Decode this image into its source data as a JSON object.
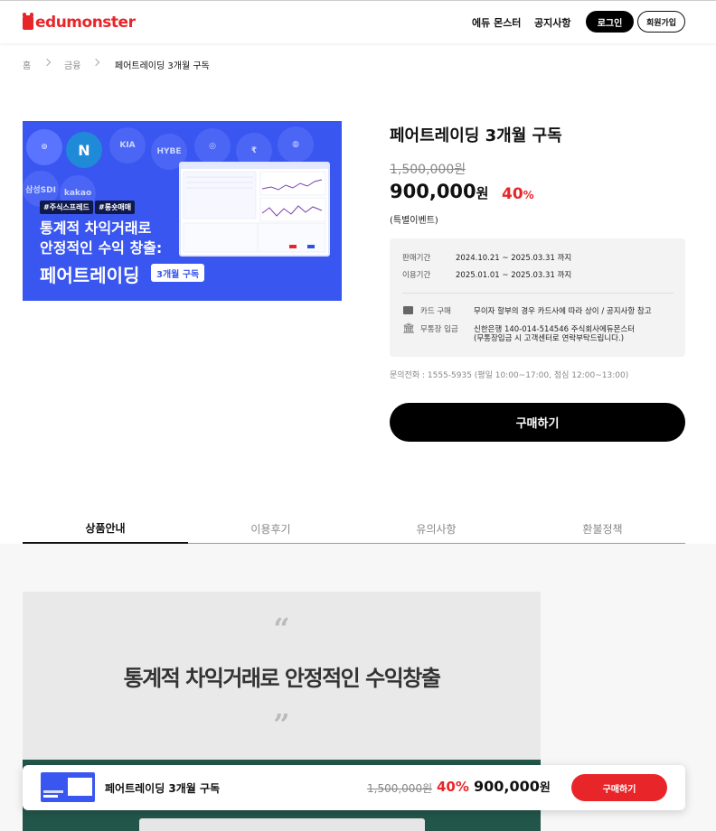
{
  "header": {
    "logo_text": "edumonster",
    "nav": [
      "에듀 몬스터",
      "공지사항"
    ],
    "login_label": "로그인",
    "join_label": "회원가입"
  },
  "breadcrumb": [
    "홈",
    "금융",
    "페어트레이딩 3개월 구독"
  ],
  "hero": {
    "logos": [
      "N",
      "KIA",
      "HYBE",
      "kakao",
      "삼성SDI"
    ],
    "tags": [
      "#주식스프레드",
      "#롱숏매매"
    ],
    "line1": "통계적 차익거래로",
    "line2": "안정적인 수익 창출:",
    "headline": "페어트레이딩",
    "badge": "3개월 구독"
  },
  "product": {
    "title": "페어트레이딩 3개월 구독",
    "original_price": "1,500,000원",
    "price": "900,000",
    "price_unit": "원",
    "discount": "40",
    "discount_unit": "%",
    "event_note": "(특별이벤트)",
    "sale_period_label": "판매기간",
    "sale_period_value": "2024.10.21 ~ 2025.03.31 까지",
    "use_period_label": "이용기간",
    "use_period_value": "2025.01.01 ~ 2025.03.31 까지",
    "card_label": "카드 구매",
    "card_value": "무이자 할부의 경우 카드사에 따라 상이 / 공지사항 참고",
    "bank_label": "무통장 입금",
    "bank_value_1": "신한은행 140-014-514546 주식회사에듀몬스터",
    "bank_value_2": "(무통장입금 시 고객센터로 연락부탁드립니다.)",
    "contact": "문의전화 : 1555-5935 (평일 10:00~17:00, 점심 12:00~13:00)",
    "buy_label": "구매하기"
  },
  "tabs": [
    "상품안내",
    "이용후기",
    "유의사항",
    "환불정책"
  ],
  "content": {
    "open_quote": "“",
    "close_quote": "”",
    "headline": "통계적 차익거래로 안정적인 수익창출"
  },
  "sticky_bar": {
    "title": "페어트레이딩 3개월 구독",
    "original_price": "1,500,000원",
    "discount": "40%",
    "price": "900,000",
    "price_unit": "원",
    "buy_label": "구매하기"
  },
  "colors": {
    "brand_red": "#e8262a",
    "hero_blue": "#3a56f0",
    "content_green": "#23564a"
  }
}
